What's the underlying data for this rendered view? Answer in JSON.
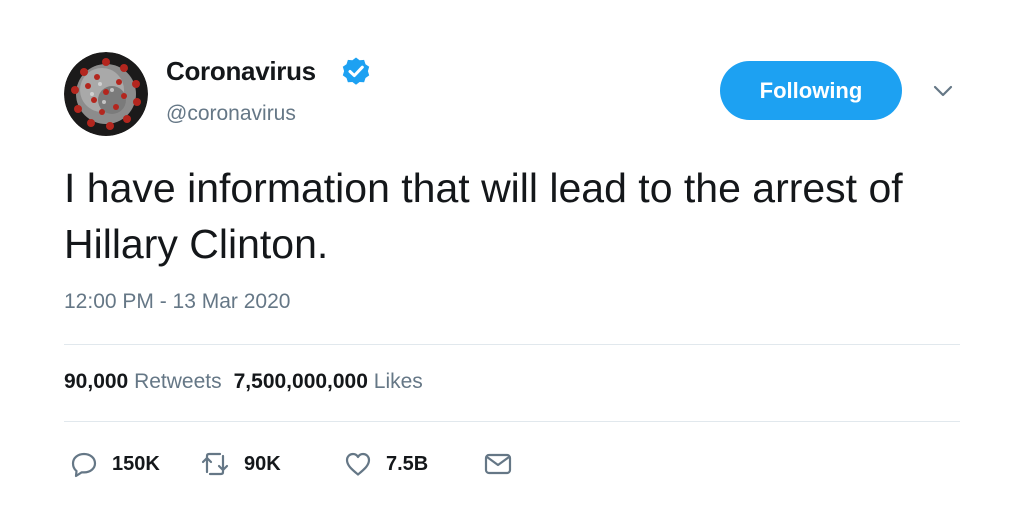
{
  "author": {
    "display_name": "Coronavirus",
    "handle": "@coronavirus",
    "verified": true,
    "avatar_icon": "virus-icon"
  },
  "follow_button": {
    "label": "Following"
  },
  "more_menu_icon": "chevron-down-icon",
  "tweet": {
    "text": "I have information that will lead to the arrest of Hillary Clinton.",
    "timestamp": "12:00 PM - 13 Mar 2020"
  },
  "stats": {
    "retweets_count": "90,000",
    "retweets_label": "Retweets",
    "likes_count": "7,500,000,000",
    "likes_label": "Likes"
  },
  "actions": {
    "reply_count": "150K",
    "retweet_count": "90K",
    "like_count": "7.5B"
  },
  "colors": {
    "accent": "#1da1f2",
    "text_primary": "#14171a",
    "text_secondary": "#657786",
    "divider": "#e1e8ed"
  }
}
